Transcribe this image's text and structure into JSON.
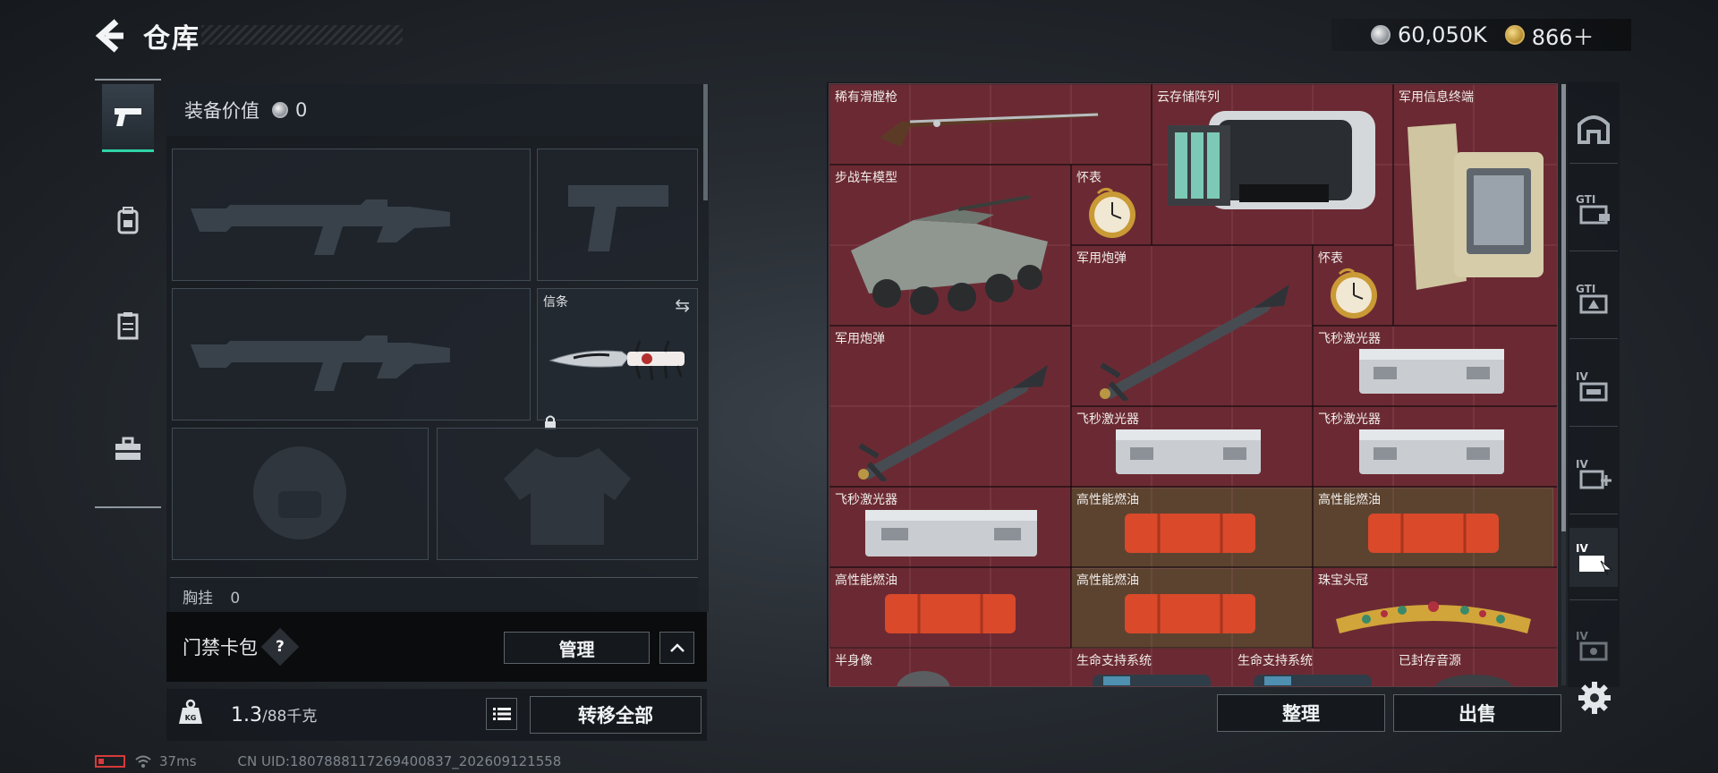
{
  "header": {
    "title": "仓库",
    "currency_silver": "60,050K",
    "currency_gold": "866＋"
  },
  "left_rail": {
    "items": [
      "pistol-icon",
      "backpack-icon",
      "chest-rig-icon",
      "toolbox-icon"
    ],
    "active": 0
  },
  "equipment": {
    "value_label": "装备价值",
    "value": "0",
    "slot_letter_label": "信条",
    "chest_label": "胸挂",
    "chest_value": "0"
  },
  "keycard": {
    "label": "门禁卡包",
    "help": "?",
    "manage_label": "管理"
  },
  "weight": {
    "current": "1.3",
    "max": "/88千克",
    "transfer_label": "转移全部"
  },
  "status": {
    "ping": "37ms",
    "uid": "CN UID:1807888117269400837_202609121558"
  },
  "storage": {
    "items": [
      {
        "label": "稀有滑膛枪"
      },
      {
        "label": "云存储阵列"
      },
      {
        "label": "军用信息终端"
      },
      {
        "label": "步战车模型"
      },
      {
        "label": "怀表"
      },
      {
        "label": "军用炮弹"
      },
      {
        "label": "怀表"
      },
      {
        "label": "军用炮弹"
      },
      {
        "label": "飞秒激光器"
      },
      {
        "label": "飞秒激光器"
      },
      {
        "label": "飞秒激光器"
      },
      {
        "label": "飞秒激光器"
      },
      {
        "label": "高性能燃油"
      },
      {
        "label": "高性能燃油"
      },
      {
        "label": "高性能燃油"
      },
      {
        "label": "高性能燃油"
      },
      {
        "label": "珠宝头冠"
      },
      {
        "label": "半身像"
      },
      {
        "label": "生命支持系统"
      },
      {
        "label": "生命支持系统"
      },
      {
        "label": "已封存音源"
      }
    ],
    "sort_label": "整理",
    "sell_label": "出售"
  },
  "right_rail": {
    "tabs": [
      "home-tab-icon",
      "storage-tab-1-icon",
      "storage-tab-2-icon",
      "storage-tab-3-icon",
      "storage-tab-4-icon",
      "storage-tab-5-icon",
      "storage-tab-6-icon"
    ],
    "active": 5
  },
  "colors": {
    "accent": "#2fd3a5",
    "rare_cell": "#6b2a33",
    "gold_cell": "#5c4330"
  }
}
